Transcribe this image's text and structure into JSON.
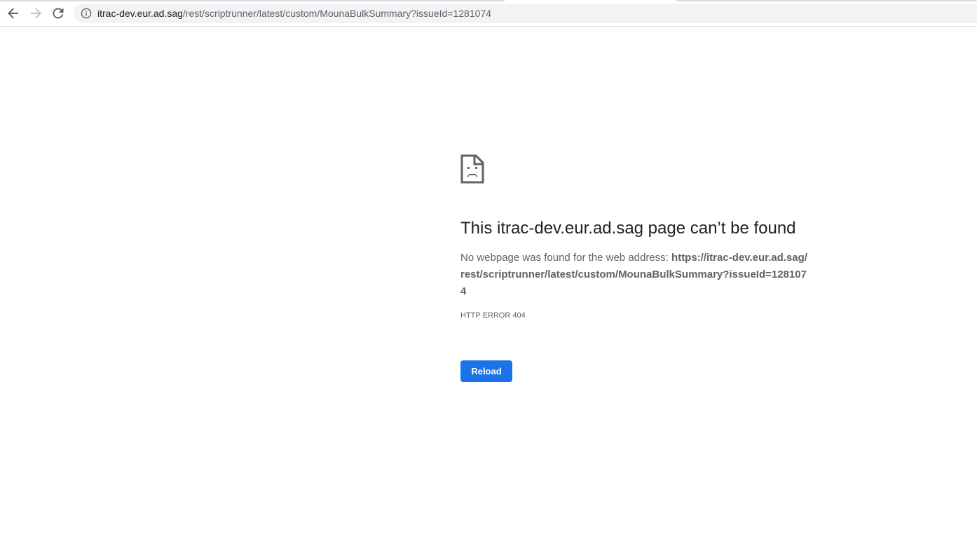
{
  "browser": {
    "url_host": "itrac-dev.eur.ad.sag",
    "url_path": "/rest/scriptrunner/latest/custom/MounaBulkSummary?issueId=1281074",
    "icons": {
      "back": "back-arrow-icon",
      "forward": "forward-arrow-icon",
      "reload": "reload-icon",
      "info": "info-icon"
    }
  },
  "error_page": {
    "icon": "sad-page-icon",
    "title": "This itrac-dev.eur.ad.sag page can’t be found",
    "desc_prefix": "No webpage was found for the web address: ",
    "desc_address": "https://itrac-dev.eur.ad.sag/rest/scriptrunner/latest/custom/MounaBulkSummary?issueId=1281074",
    "error_code": "HTTP ERROR 404",
    "reload_label": "Reload"
  },
  "colors": {
    "accent": "#1a73e8",
    "text_primary": "#202124",
    "text_secondary": "#5f6368",
    "omnibox_bg": "#f1f3f4"
  }
}
